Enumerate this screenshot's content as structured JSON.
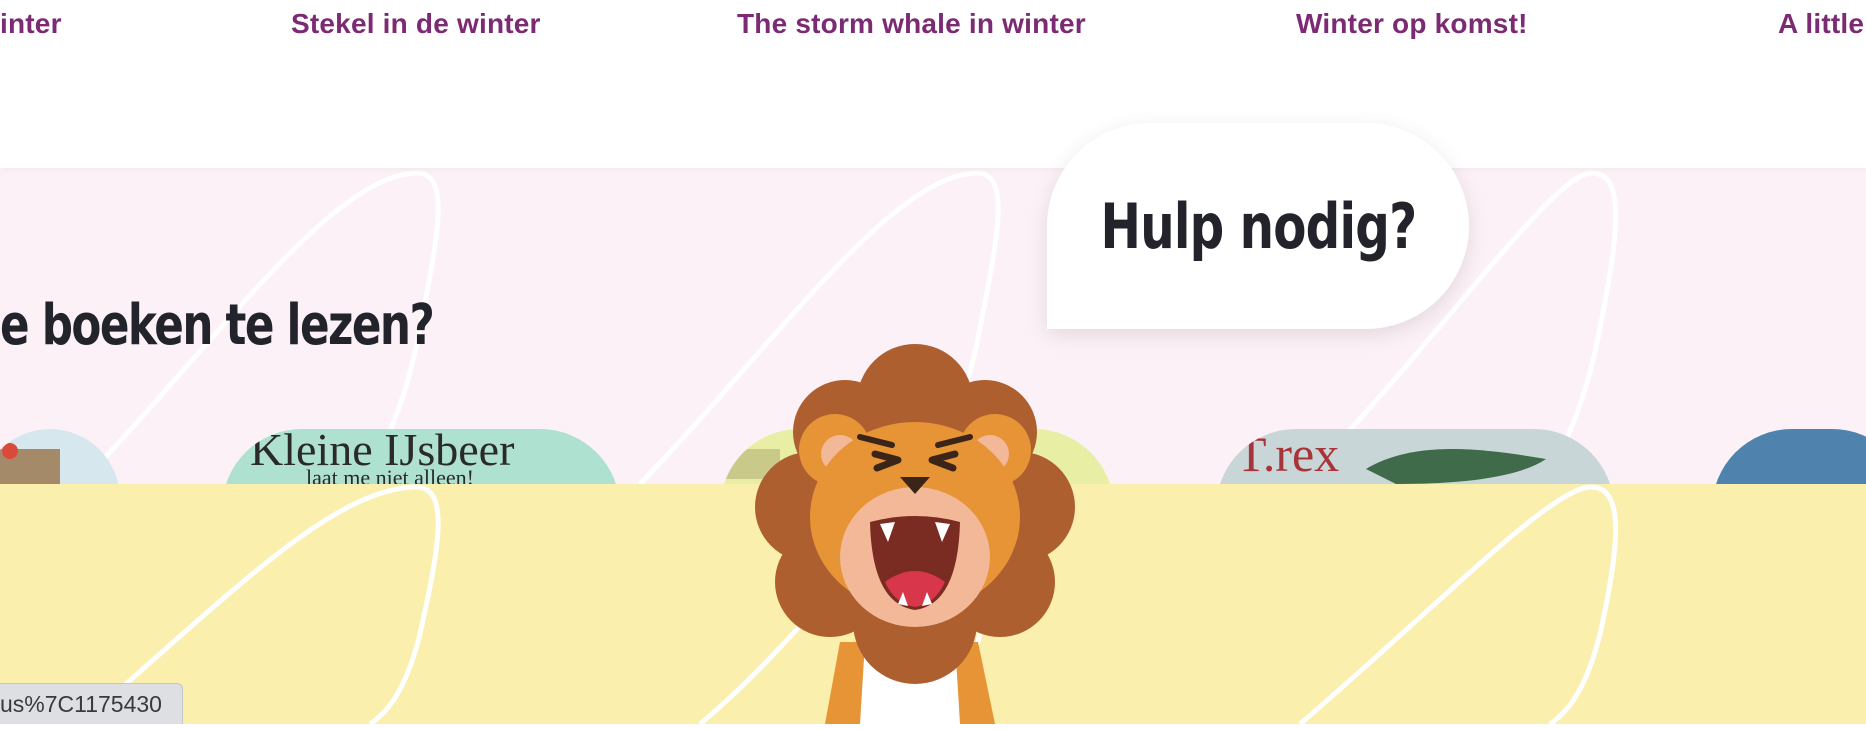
{
  "carousel": {
    "titles": [
      "inter",
      "Stekel in de winter",
      "The storm whale in winter",
      "Winter op komst!",
      "A little"
    ]
  },
  "section": {
    "heading": "e boeken te lezen?"
  },
  "covers": [
    {
      "title_fragment": "",
      "color": "#d6e7ee"
    },
    {
      "title_fragment": "Kleine IJsbeer",
      "subtitle_fragment": "laat me niet alleen!",
      "color": "#aee1cf"
    },
    {
      "title_fragment": "",
      "color": "#e8efa4"
    },
    {
      "title_fragment": "T.rex",
      "color": "#c9d6d8"
    },
    {
      "title_fragment": "",
      "color": "#4f83ad"
    }
  ],
  "help": {
    "label": "Hulp nodig?",
    "mascot": "lion-icon"
  },
  "status_bar": {
    "url_fragment": "us%7C1175430"
  },
  "colors": {
    "title_purple": "#7b2a73",
    "pink_band": "#fbf1f7",
    "yellow_band": "#faefac",
    "heading_dark": "#23232b"
  }
}
